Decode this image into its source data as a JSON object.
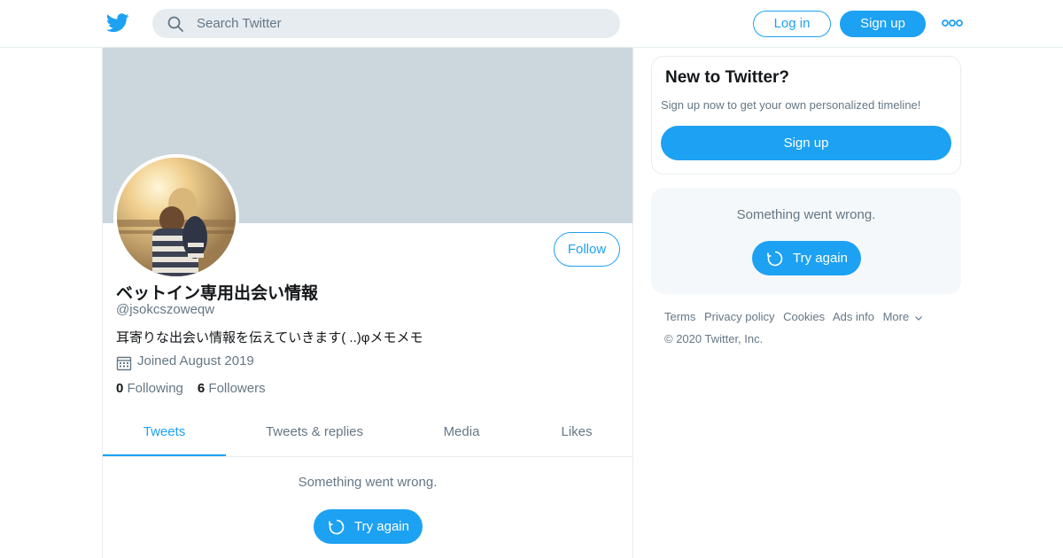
{
  "header": {
    "search_placeholder": "Search Twitter",
    "login_label": "Log in",
    "signup_label": "Sign up"
  },
  "profile": {
    "display_name": "ベットイン専用出会い情報",
    "handle": "@jsokcszoweqw",
    "bio": "耳寄りな出会い情報を伝えていきます( ..)φメモメモ",
    "joined": "Joined August 2019",
    "following_count": "0",
    "following_label": "Following",
    "followers_count": "6",
    "followers_label": "Followers",
    "follow_label": "Follow"
  },
  "tabs": [
    {
      "label": "Tweets",
      "active": true
    },
    {
      "label": "Tweets & replies",
      "active": false
    },
    {
      "label": "Media",
      "active": false
    },
    {
      "label": "Likes",
      "active": false
    }
  ],
  "timeline": {
    "error_message": "Something went wrong.",
    "try_again_label": "Try again"
  },
  "sidebar": {
    "new_title": "New to Twitter?",
    "new_subtitle": "Sign up now to get your own personalized timeline!",
    "signup_label": "Sign up",
    "error_message": "Something went wrong.",
    "try_again_label": "Try again"
  },
  "footer": {
    "links": [
      "Terms",
      "Privacy policy",
      "Cookies",
      "Ads info",
      "More"
    ],
    "copyright": "© 2020 Twitter, Inc."
  },
  "colors": {
    "accent": "#1da1f2",
    "banner": "#ccd6dd",
    "secondary_text": "#657786",
    "border": "#e6ecf0"
  },
  "icons": [
    "twitter-bird-icon",
    "search-icon",
    "more-dots-icon",
    "calendar-icon",
    "refresh-icon",
    "chevron-down-icon"
  ]
}
